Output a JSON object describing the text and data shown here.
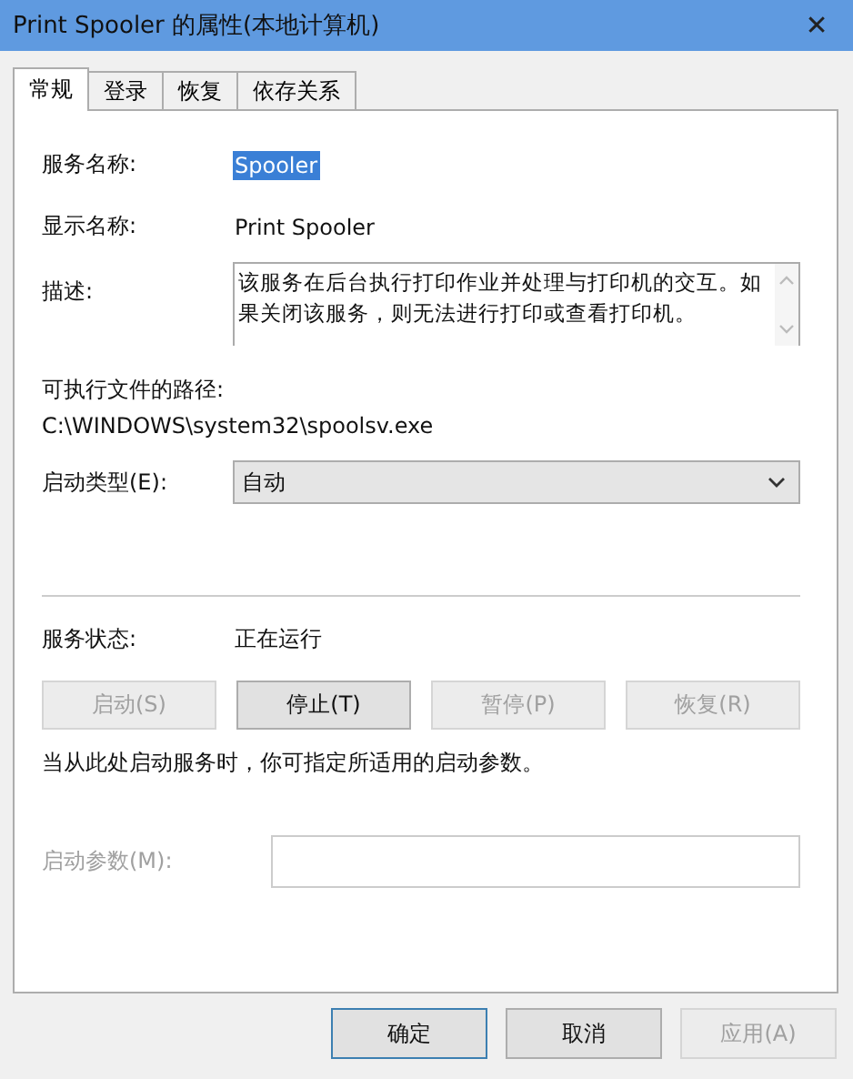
{
  "window": {
    "title": "Print Spooler 的属性(本地计算机)",
    "close": "✕"
  },
  "tabs": [
    {
      "label": "常规",
      "selected": true
    },
    {
      "label": "登录",
      "selected": false
    },
    {
      "label": "恢复",
      "selected": false
    },
    {
      "label": "依存关系",
      "selected": false
    }
  ],
  "service_name": {
    "label": "服务名称:",
    "value": "Spooler",
    "selected": true
  },
  "display_name": {
    "label": "显示名称:",
    "value": "Print Spooler"
  },
  "description": {
    "label": "描述:",
    "value": "该服务在后台执行打印作业并处理与打印机的交互。如果关闭该服务，则无法进行打印或查看打印机。"
  },
  "executable_path": {
    "label": "可执行文件的路径:",
    "value": "C:\\WINDOWS\\system32\\spoolsv.exe"
  },
  "startup_type": {
    "label": "启动类型(E):",
    "value": "自动"
  },
  "service_status": {
    "label": "服务状态:",
    "value": "正在运行"
  },
  "status_buttons": [
    {
      "label": "启动(S)",
      "disabled": true
    },
    {
      "label": "停止(T)",
      "disabled": false
    },
    {
      "label": "暂停(P)",
      "disabled": true
    },
    {
      "label": "恢复(R)",
      "disabled": true
    }
  ],
  "hint": "当从此处启动服务时，你可指定所适用的启动参数。",
  "start_parameters": {
    "label": "启动参数(M):",
    "disabled": true
  },
  "dialog_buttons": [
    {
      "label": "确定",
      "disabled": false,
      "default": true
    },
    {
      "label": "取消",
      "disabled": false,
      "default": false
    },
    {
      "label": "应用(A)",
      "disabled": true,
      "default": false
    }
  ]
}
